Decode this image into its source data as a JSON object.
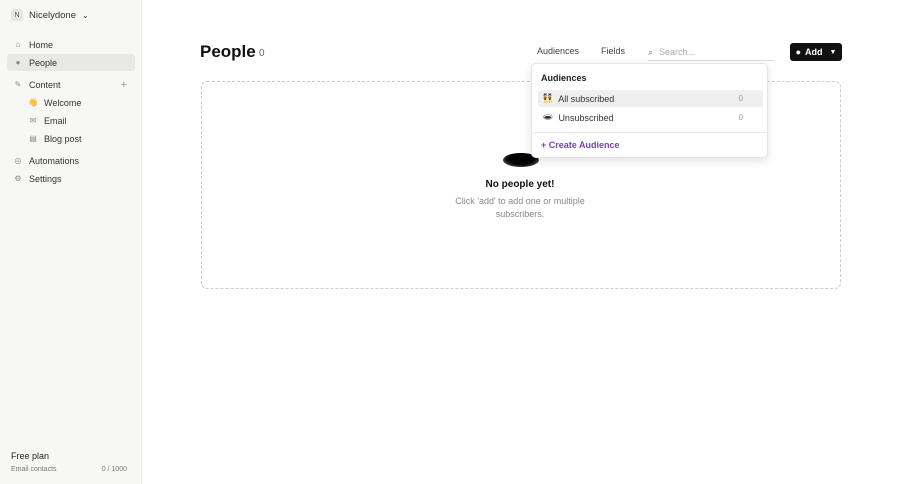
{
  "workspace": {
    "initial": "N",
    "name": "Nicelydone"
  },
  "sidebar": {
    "items": [
      {
        "label": "Home"
      },
      {
        "label": "People"
      },
      {
        "label": "Content"
      },
      {
        "label": "Welcome"
      },
      {
        "label": "Email"
      },
      {
        "label": "Blog post"
      },
      {
        "label": "Automations"
      },
      {
        "label": "Settings"
      }
    ],
    "plan": "Free plan",
    "contacts_label": "Email contacts",
    "contacts_value": "0 / 1000"
  },
  "header": {
    "title": "People",
    "count": "0",
    "audiences": "Audiences",
    "fields": "Fields",
    "search_placeholder": "Search...",
    "add": "Add"
  },
  "empty": {
    "title": "No people yet!",
    "text": "Click 'add' to add one or multiple subscribers."
  },
  "dropdown": {
    "heading": "Audiences",
    "items": [
      {
        "emoji": "👯",
        "label": "All subscribed",
        "count": "0"
      },
      {
        "emoji": "🕳",
        "label": "Unsubscribed",
        "count": "0"
      }
    ],
    "create": "Create Audience"
  },
  "colors": {
    "accent": "#7b3fc4"
  }
}
